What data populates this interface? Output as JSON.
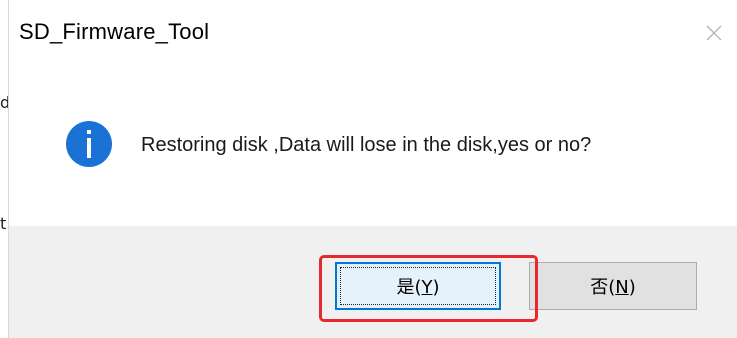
{
  "window": {
    "title": "SD_Firmware_Tool"
  },
  "message": {
    "text": "Restoring disk ,Data will lose in the disk,yes or no?",
    "icon": "info-icon"
  },
  "buttons": {
    "yes": {
      "label_main": "是(",
      "mnemonic": "Y",
      "label_end": ")"
    },
    "no": {
      "label_main": "否(",
      "mnemonic": "N",
      "label_end": ")"
    }
  },
  "edge_text": {
    "glyph_1": "d",
    "glyph_2": "t"
  },
  "colors": {
    "info_icon": "#1a73d4",
    "highlight": "#e8282d",
    "footer_bg": "#f0f0f0",
    "default_button_border": "#0078d7"
  }
}
